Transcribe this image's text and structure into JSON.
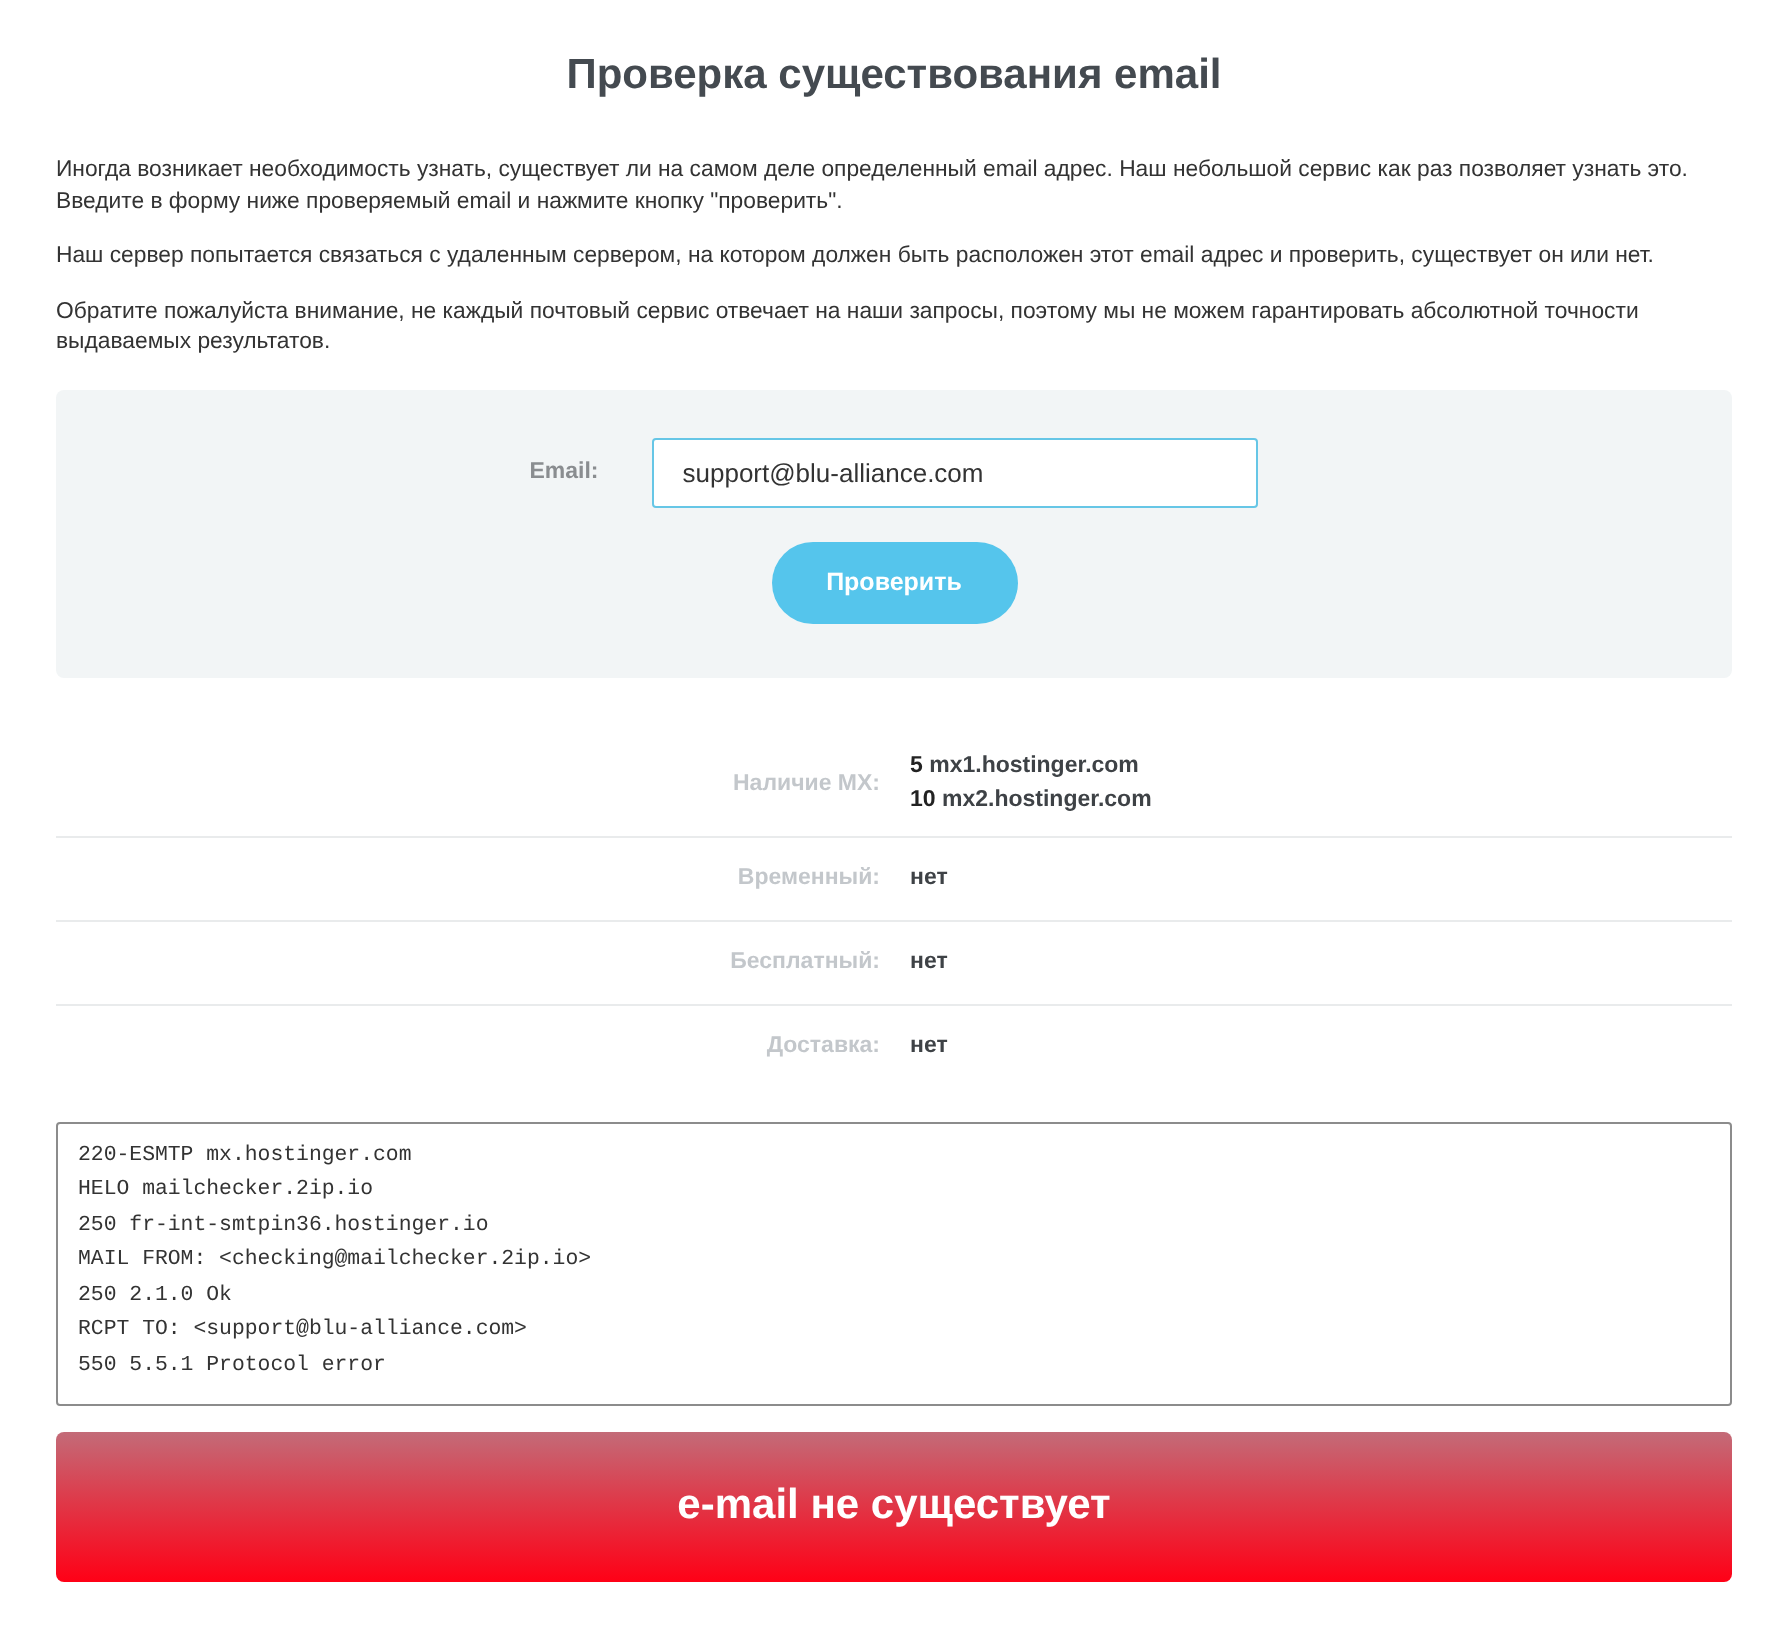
{
  "title": "Проверка существования email",
  "intro": [
    "Иногда возникает необходимость узнать, существует ли на самом деле определенный email адрес. Наш небольшой сервис как раз позволяет узнать это. Введите в форму ниже проверяемый email и нажмите кнопку \"проверить\".",
    "Наш сервер попытается связаться с удаленным сервером, на котором должен быть расположен этот email адрес и проверить, существует он или нет.",
    "Обратите пожалуйста внимание, не каждый почтовый сервис отвечает на наши запросы, поэтому мы не можем гарантировать абсолютной точности выдаваемых результатов."
  ],
  "form": {
    "label": "Email:",
    "value": "support@blu-alliance.com",
    "focused": true,
    "button": "Проверить"
  },
  "results": [
    {
      "label": "Наличие MX:",
      "values": [
        "**5** mx1.hostinger.com",
        "**10** mx2.hostinger.com"
      ]
    },
    {
      "label": "Временный:",
      "values": [
        "нет"
      ]
    },
    {
      "label": "Бесплатный:",
      "values": [
        "нет"
      ]
    },
    {
      "label": "Доставка:",
      "values": [
        "нет"
      ]
    }
  ],
  "log": [
    "220-ESMTP mx.hostinger.com",
    "HELO mailchecker.2ip.io",
    "250 fr-int-smtpin36.hostinger.io",
    "MAIL FROM: <checking@mailchecker.2ip.io>",
    "250 2.1.0 Ok",
    "RCPT TO: <support@blu-alliance.com>",
    "550 5.5.1 Protocol error"
  ],
  "verdict": {
    "kind": "error",
    "text": "e-mail не существует"
  }
}
